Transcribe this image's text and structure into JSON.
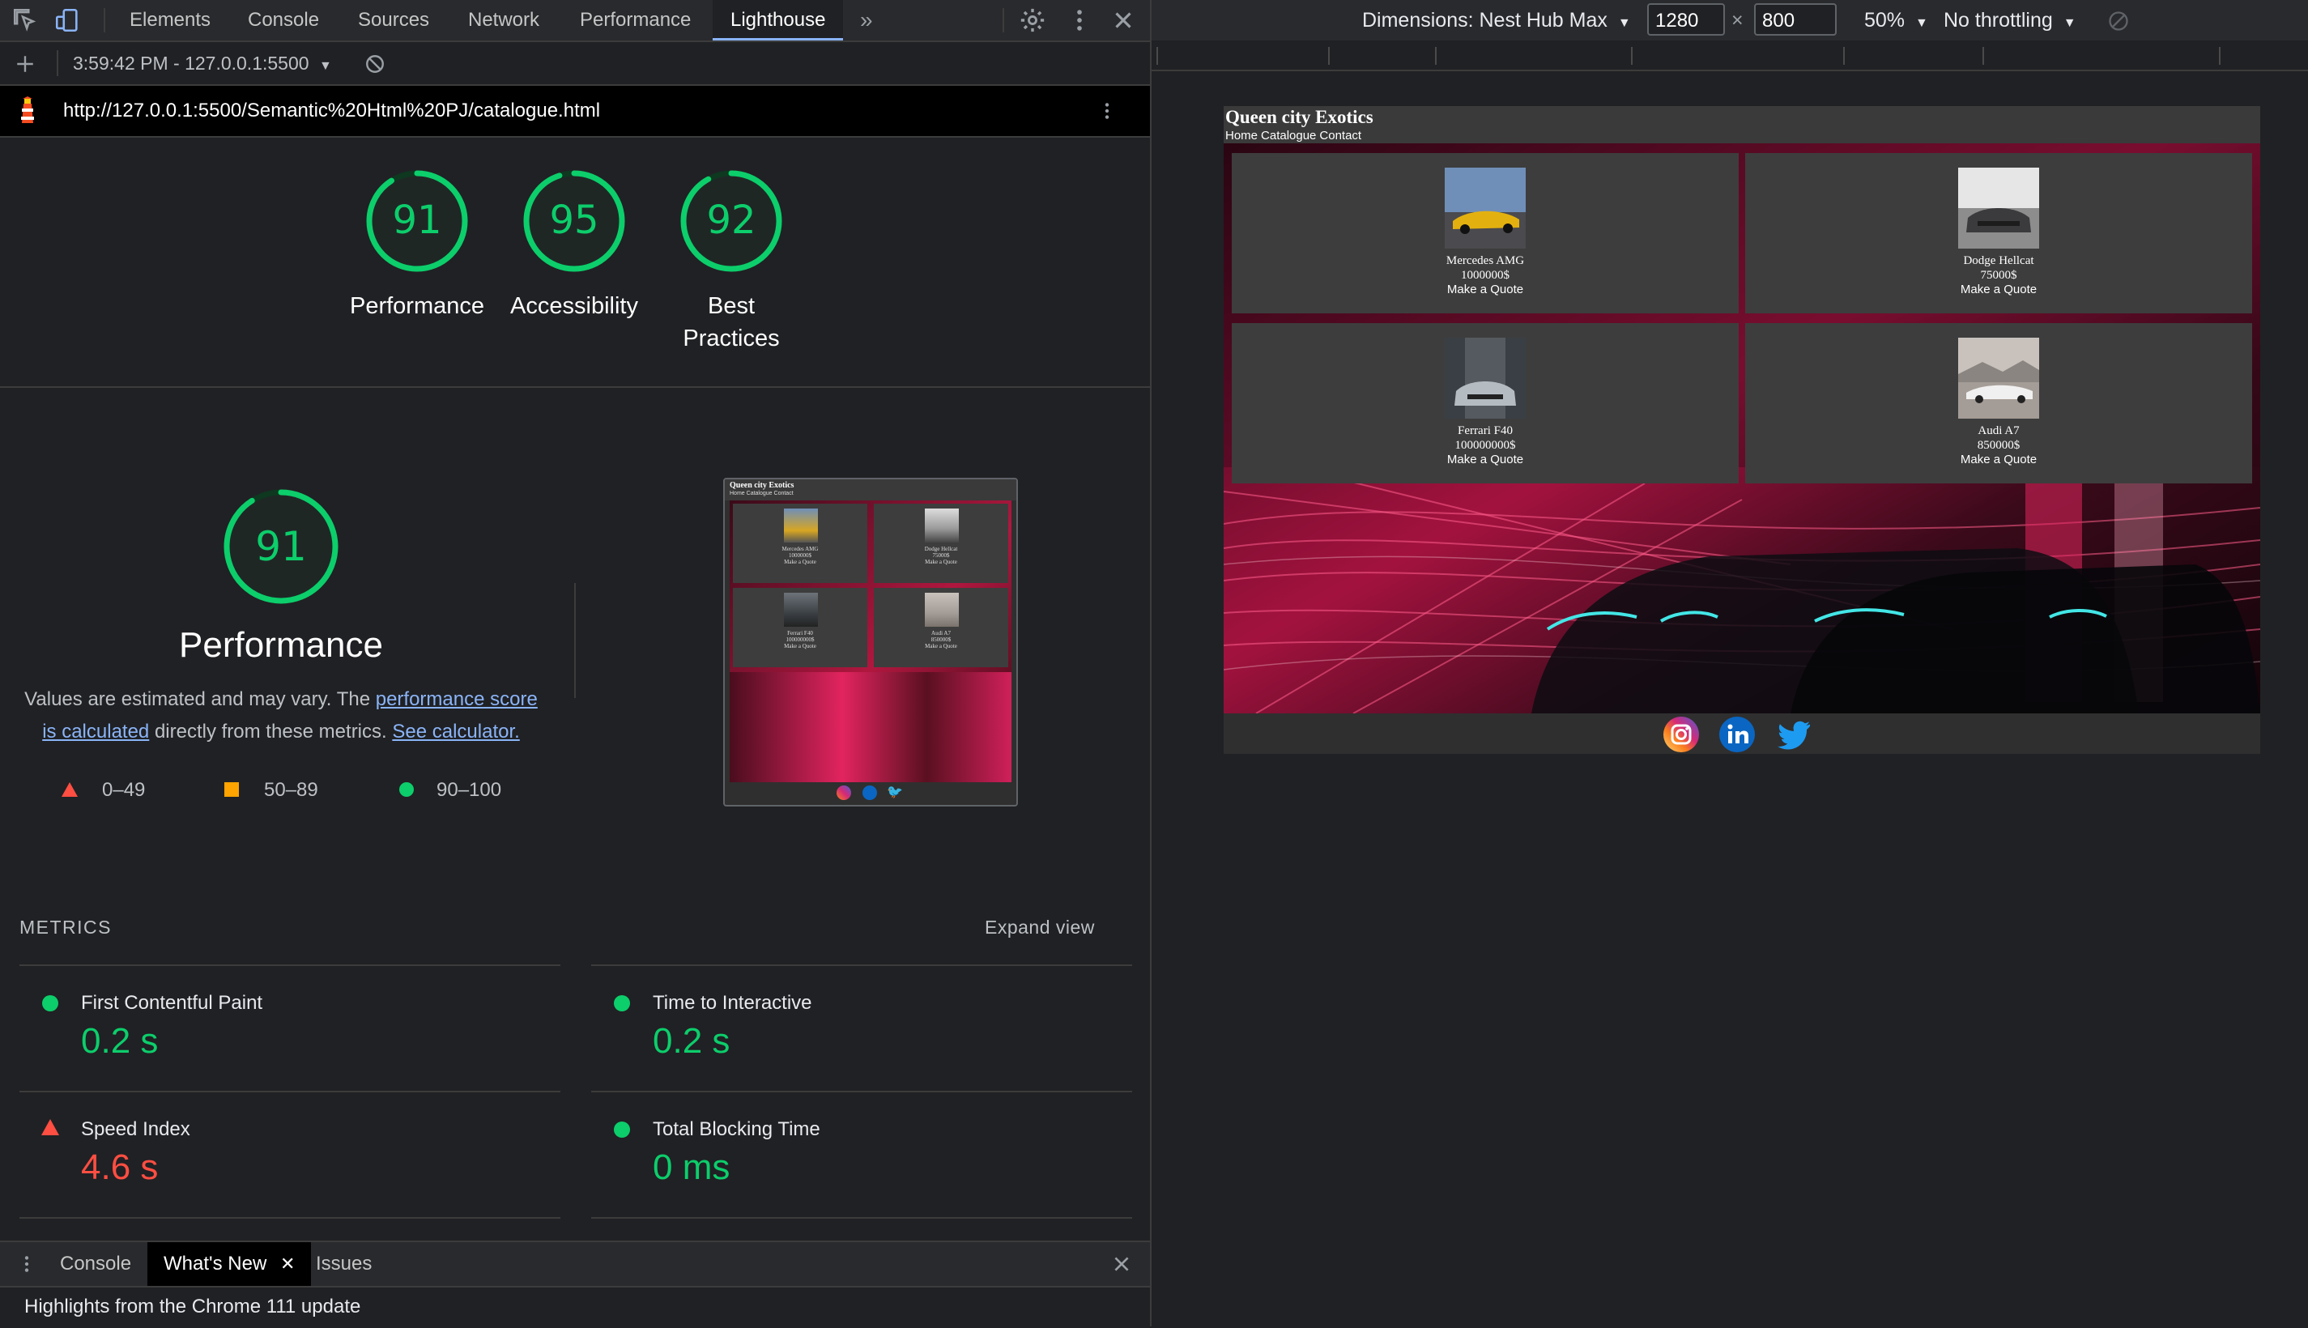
{
  "devtools": {
    "tabs": [
      "Elements",
      "Console",
      "Sources",
      "Network",
      "Performance",
      "Lighthouse"
    ],
    "active_tab": "Lighthouse",
    "report_selector": "3:59:42 PM - 127.0.0.1:5500",
    "url": "http://127.0.0.1:5500/Semantic%20Html%20PJ/catalogue.html",
    "scores": [
      {
        "value": "91",
        "label": "Performance",
        "score": 91
      },
      {
        "value": "95",
        "label": "Accessibility",
        "score": 95
      },
      {
        "value": "92",
        "label_line1": "Best",
        "label_line2": "Practices",
        "score": 92
      }
    ],
    "perf": {
      "score": "91",
      "title": "Performance",
      "desc_start": "Values are estimated and may vary. The ",
      "desc_link1a": "performance score",
      "desc_link1b": "is calculated",
      "desc_mid": " directly from these metrics. ",
      "desc_link2": "See calculator.",
      "legend": [
        "0–49",
        "50–89",
        "90–100"
      ]
    },
    "metrics": {
      "heading": "METRICS",
      "expand": "Expand view",
      "items": [
        {
          "name": "First Contentful Paint",
          "value": "0.2 s",
          "status": "pass"
        },
        {
          "name": "Time to Interactive",
          "value": "0.2 s",
          "status": "pass"
        },
        {
          "name": "Speed Index",
          "value": "4.6 s",
          "status": "fail"
        },
        {
          "name": "Total Blocking Time",
          "value": "0 ms",
          "status": "pass"
        }
      ]
    },
    "drawer": {
      "tabs": [
        "Console",
        "What's New",
        "Issues"
      ],
      "active_tab": "What's New",
      "message": "Highlights from the Chrome 111 update"
    }
  },
  "device_toolbar": {
    "dimensions": "Dimensions: Nest Hub Max",
    "width": "1280",
    "height": "800",
    "times": "×",
    "zoom": "50%",
    "throttling": "No throttling"
  },
  "site": {
    "title": "Queen city Exotics",
    "nav": [
      "Home",
      "Catalogue",
      "Contact"
    ],
    "cars": [
      {
        "name": "Mercedes AMG",
        "price": "1000000$",
        "cta": "Make a Quote"
      },
      {
        "name": "Dodge Hellcat",
        "price": "75000$",
        "cta": "Make a Quote"
      },
      {
        "name": "Ferrari F40",
        "price": "100000000$",
        "cta": "Make a Quote"
      },
      {
        "name": "Audi A7",
        "price": "850000$",
        "cta": "Make a Quote"
      }
    ],
    "social": [
      "instagram-icon",
      "linkedin-icon",
      "twitter-icon"
    ]
  },
  "colors": {
    "pass": "#0cce6b",
    "average": "#ffa400",
    "fail": "#ff4e42",
    "link": "#8ab4f8",
    "accent_pink": "#e2245f"
  }
}
